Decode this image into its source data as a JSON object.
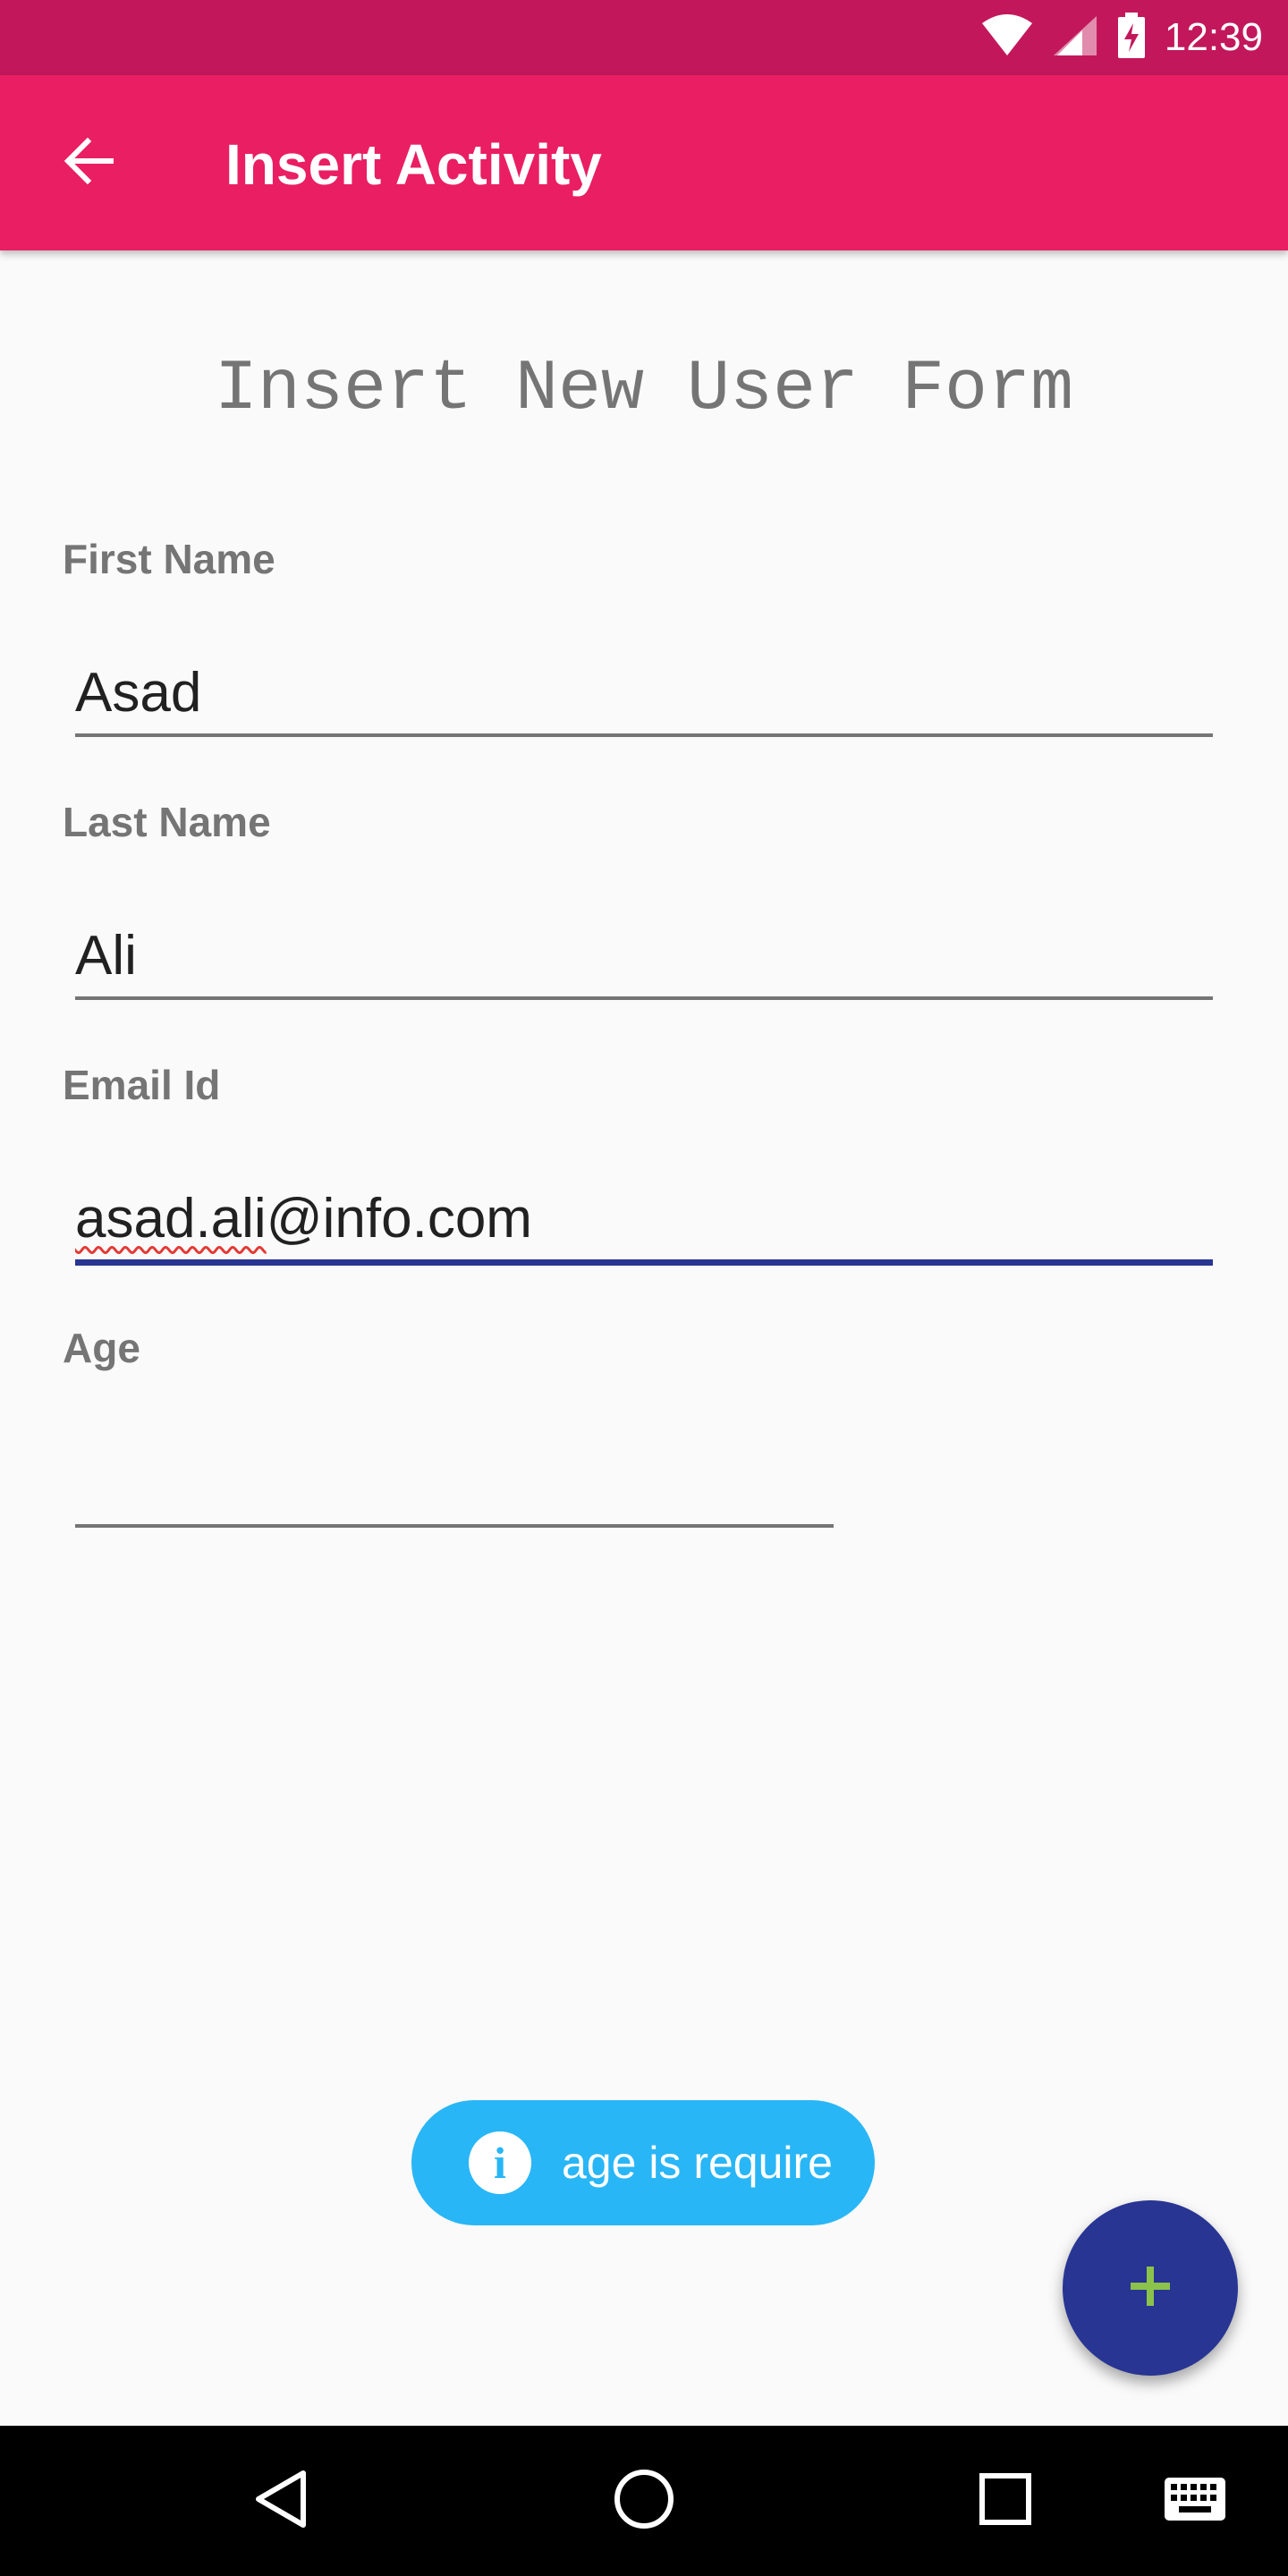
{
  "status_bar": {
    "time": "12:39",
    "icons": [
      "wifi-icon",
      "signal-icon",
      "battery-charging-icon"
    ]
  },
  "app_bar": {
    "title": "Insert Activity",
    "back_icon": "arrow-back-icon"
  },
  "form": {
    "title": "Insert New User Form",
    "fields": [
      {
        "label": "First Name",
        "value": "Asad"
      },
      {
        "label": "Last Name",
        "value": "Ali"
      },
      {
        "label": "Email Id",
        "value_part1": "asad.ali",
        "value_part2": "@info.com"
      },
      {
        "label": "Age",
        "value": ""
      }
    ]
  },
  "toast": {
    "icon": "i",
    "message": "age is require"
  },
  "fab": {
    "icon": "plus-icon"
  },
  "nav_bar": {
    "icons": [
      "back-triangle-icon",
      "home-circle-icon",
      "recents-square-icon",
      "keyboard-icon"
    ]
  },
  "colors": {
    "status_bar": "#c2185b",
    "app_bar": "#e91e63",
    "toast": "#29b6f6",
    "fab": "#283593",
    "fab_icon": "#8bc34a",
    "focus_underline": "#283593"
  }
}
